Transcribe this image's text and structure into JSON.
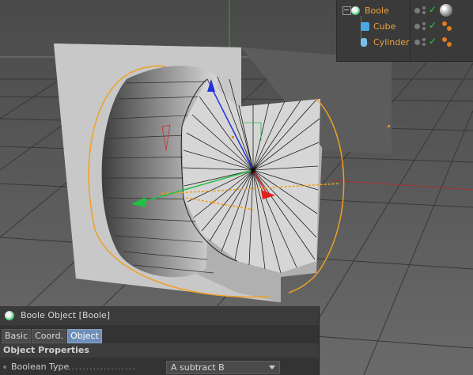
{
  "object_manager": {
    "objects": [
      {
        "name": "Boole",
        "icon": "boole-icon"
      },
      {
        "name": "Cube",
        "icon": "cube-icon"
      },
      {
        "name": "Cylinder",
        "icon": "cylinder-icon"
      }
    ]
  },
  "attribute_manager": {
    "title": "Boole Object [Boole]",
    "tabs": [
      "Basic",
      "Coord.",
      "Object"
    ],
    "active_tab": "Object",
    "section_title": "Object Properties",
    "param_label": "Boolean Type",
    "param_dots": "...................",
    "param_value": "A subtract B"
  },
  "colors": {
    "object_name": "#e8a33a",
    "selection_outline": "#f0a020",
    "axis_x": "#e02020",
    "axis_y": "#2030e0",
    "axis_z": "#20c040",
    "active_tab": "#6f8fb8"
  }
}
